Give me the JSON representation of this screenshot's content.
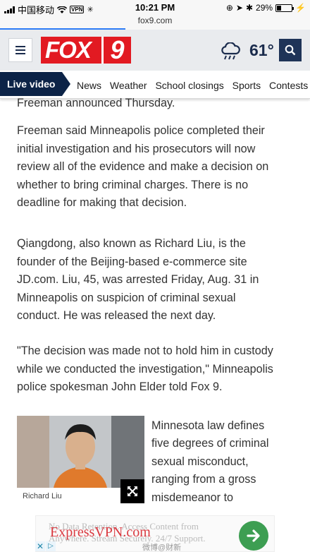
{
  "status_bar": {
    "carrier": "中国移动",
    "vpn": "VPN",
    "time": "10:21 PM",
    "battery_percent": "29%",
    "battery_level": 0.29
  },
  "browser": {
    "url": "fox9.com"
  },
  "header": {
    "logo_text": "FOX",
    "logo_number": "9",
    "temperature": "61°",
    "weather_icon": "rain-cloud-icon",
    "brand_color": "#e21a22"
  },
  "nav": {
    "live_label": "Live video",
    "items": [
      "News",
      "Weather",
      "School closings",
      "Sports",
      "Contests"
    ]
  },
  "article": {
    "cut_line": "Freeman announced Thursday.",
    "paragraphs": [
      "Freeman said Minneapolis police completed their initial investigation and his prosecutors will now review all of the evidence and make a decision on whether to bring criminal charges. There is no deadline for making that decision.",
      "Qiangdong, also known as Richard Liu, is the founder of the Beijing-based e-commerce site JD.com. Liu, 45, was arrested Friday, Aug. 31 in Minneapolis on suspicion of criminal sexual conduct. He was released the next day.",
      "\"The decision was made not to hold him in custody while we conducted the investigation,\" Minneapolis police spokesman John Elder told Fox 9."
    ],
    "float_text": "Minnesota law defines five degrees of criminal sexual misconduct, ranging from a gross misdemeanor to",
    "photo_caption": "Richard Liu"
  },
  "ad": {
    "faint_text": "No Data Retention. Access Content from Anywhere. Stream Securely. 24/7 Support.",
    "brand": "ExpressVPN.com"
  },
  "watermark": "微博@财新"
}
